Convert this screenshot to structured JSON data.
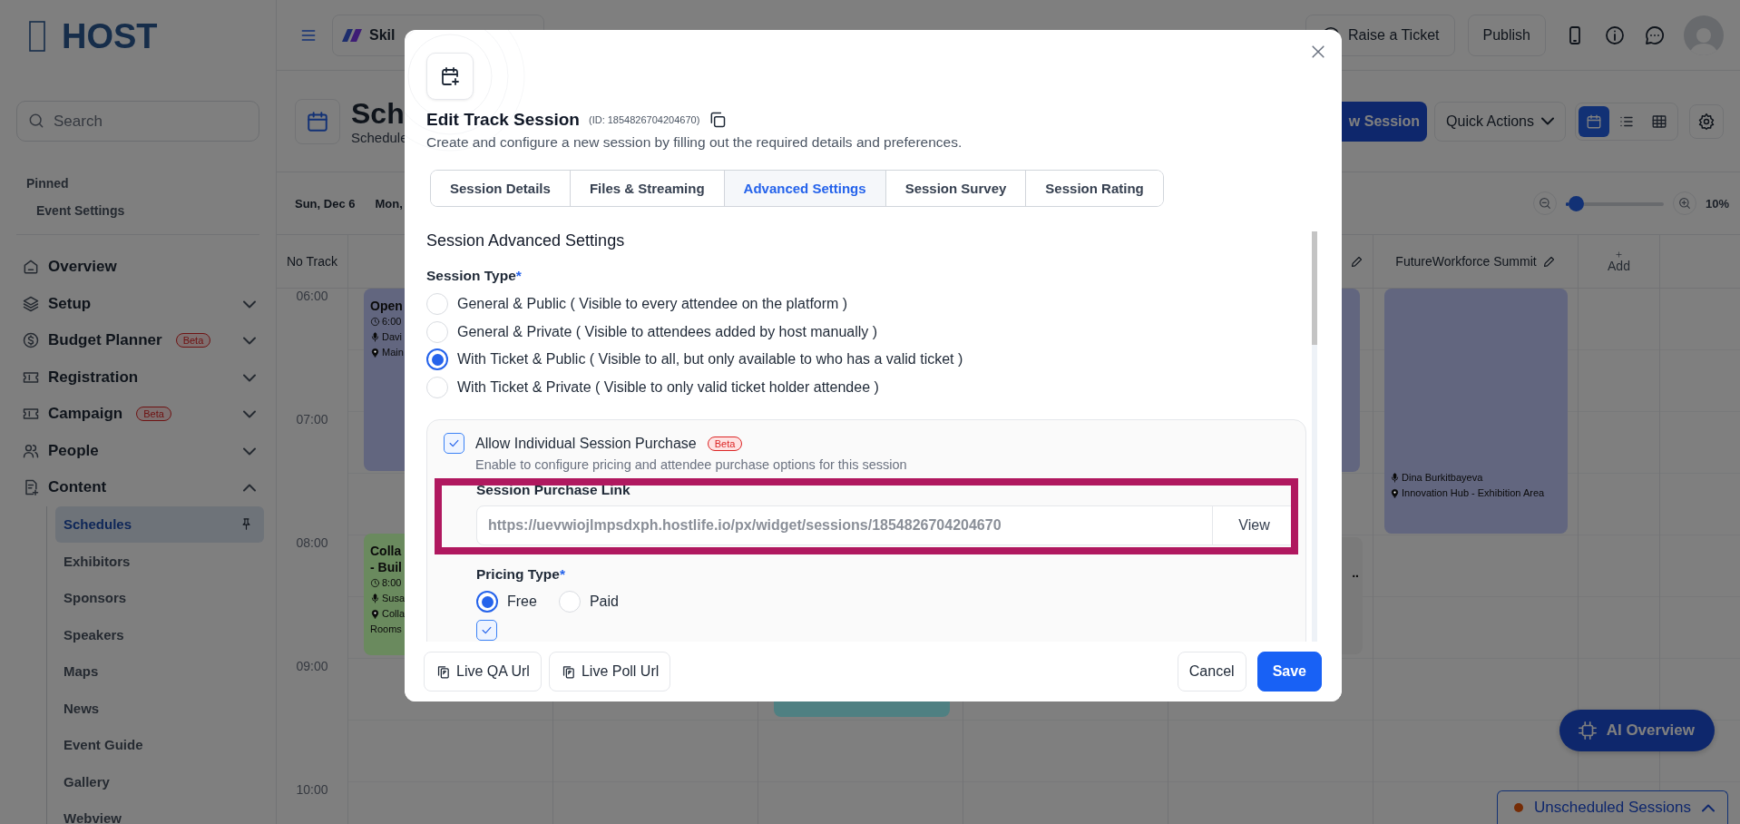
{
  "sidebar": {
    "logo": "HOST",
    "search": {
      "placeholder": "Search"
    },
    "pinned": {
      "title": "Pinned",
      "items": [
        "Event Settings"
      ]
    },
    "nav": [
      {
        "label": "Overview"
      },
      {
        "label": "Setup",
        "expanded": false
      },
      {
        "label": "Budget Planner",
        "badge": "Beta",
        "expanded": false
      },
      {
        "label": "Registration",
        "expanded": false
      },
      {
        "label": "Campaign",
        "badge": "Beta",
        "expanded": false
      },
      {
        "label": "People",
        "expanded": false
      },
      {
        "label": "Content",
        "expanded": true,
        "children": [
          {
            "label": "Schedules",
            "selected": true,
            "pinned": true
          },
          {
            "label": "Exhibitors",
            "selected": false,
            "pinned": false
          },
          {
            "label": "Sponsors",
            "selected": false,
            "pinned": false
          },
          {
            "label": "Speakers",
            "selected": false,
            "pinned": false
          },
          {
            "label": "Maps",
            "selected": false,
            "pinned": false
          },
          {
            "label": "News",
            "selected": false,
            "pinned": false
          },
          {
            "label": "Event Guide",
            "selected": false,
            "pinned": false
          },
          {
            "label": "Gallery",
            "selected": false,
            "pinned": false
          },
          {
            "label": "Webview",
            "selected": false,
            "pinned": false
          }
        ]
      }
    ]
  },
  "topbar": {
    "event": "Skil",
    "actions": [
      "Raise a Ticket",
      "Publish"
    ]
  },
  "page_header": {
    "title": "Sch",
    "subtitle": "Schedule",
    "primary_action": "w Session",
    "menu": "Quick Actions",
    "views": [
      {
        "selected": true
      },
      {
        "selected": false
      },
      {
        "selected": false
      }
    ]
  },
  "toolbar": {
    "dates": [
      "Sun, Dec 6",
      "Mon,"
    ],
    "zoom": {
      "level": 0.03,
      "reading": "10%"
    }
  },
  "calendar": {
    "corner": "No Track",
    "track": "FutureWorkforce Summit",
    "add": "Add",
    "times": [
      "06:00",
      "07:00",
      "08:00",
      "09:00",
      "10:00"
    ],
    "events": [
      {
        "color": "#62667f",
        "lines": [
          {
            "kind": "title",
            "text": "Open"
          },
          {
            "kind": "time",
            "text": "6:00"
          },
          {
            "kind": "speaker",
            "text": "Davi"
          },
          {
            "kind": "location",
            "text": "Main"
          }
        ]
      },
      {
        "color": "#6a8a5e",
        "lines": [
          {
            "kind": "title",
            "text": "Colla"
          },
          {
            "kind": "title",
            "text": "- Buil"
          },
          {
            "kind": "time",
            "text": "8:00"
          },
          {
            "kind": "speaker",
            "text": "Susa"
          },
          {
            "kind": "location",
            "text": "Colla"
          },
          {
            "kind": "plain",
            "text": "Rooms"
          }
        ]
      },
      {
        "color": "#4f8082"
      },
      {
        "color": "#62667f"
      },
      {
        "color": "#7a7a7a",
        "lines": [
          {
            "kind": "title",
            "text": ".."
          }
        ]
      },
      {
        "color": "#62667f",
        "lines": [
          {
            "kind": "speaker",
            "text": "Dina Burkitbayeva"
          },
          {
            "kind": "location",
            "text": "Innovation Hub - Exhibition Area"
          }
        ]
      }
    ]
  },
  "floating": {
    "assistant": "AI Overview",
    "unscheduled": "Unscheduled Sessions"
  },
  "modal": {
    "title": "Edit Track Session",
    "id": "(ID: 1854826704204670)",
    "description": "Create and configure a new session by filling out the required details and preferences.",
    "tabs": [
      {
        "label": "Session Details",
        "selected": false
      },
      {
        "label": "Files & Streaming",
        "selected": false
      },
      {
        "label": "Advanced Settings",
        "selected": true
      },
      {
        "label": "Session Survey",
        "selected": false
      },
      {
        "label": "Session Rating",
        "selected": false
      }
    ],
    "section_title": "Session Advanced Settings",
    "session_type": {
      "label": "Session Type",
      "required_mark": "*",
      "options": [
        {
          "label": "General & Public ( Visible to every attendee on the platform )",
          "selected": false
        },
        {
          "label": "General & Private ( Visible to attendees added by host manually )",
          "selected": false
        },
        {
          "label": "With Ticket & Public ( Visible to all, but only available to who has a valid ticket )",
          "selected": true
        },
        {
          "label": "With Ticket & Private ( Visible to only valid ticket holder attendee )",
          "selected": false
        }
      ]
    },
    "purchase": {
      "label": "Allow Individual Session Purchase",
      "checked": true,
      "badge": "Beta",
      "description": "Enable to configure pricing and attendee purchase options for this session",
      "link": {
        "label": "Session Purchase Link",
        "value": "https://uevwiojlmpsdxph.hostlife.io/px/widget/sessions/1854826704204670",
        "button": "View",
        "highlighted": true
      },
      "pricing": {
        "label": "Pricing Type",
        "required_mark": "*",
        "options": [
          {
            "label": "Free",
            "selected": true
          },
          {
            "label": "Paid",
            "selected": false
          }
        ]
      },
      "new_attendees": {
        "checked": true
      }
    },
    "footer": {
      "links": [
        "Live QA Url",
        "Live Poll Url"
      ],
      "cancel": "Cancel",
      "save": "Save"
    }
  }
}
